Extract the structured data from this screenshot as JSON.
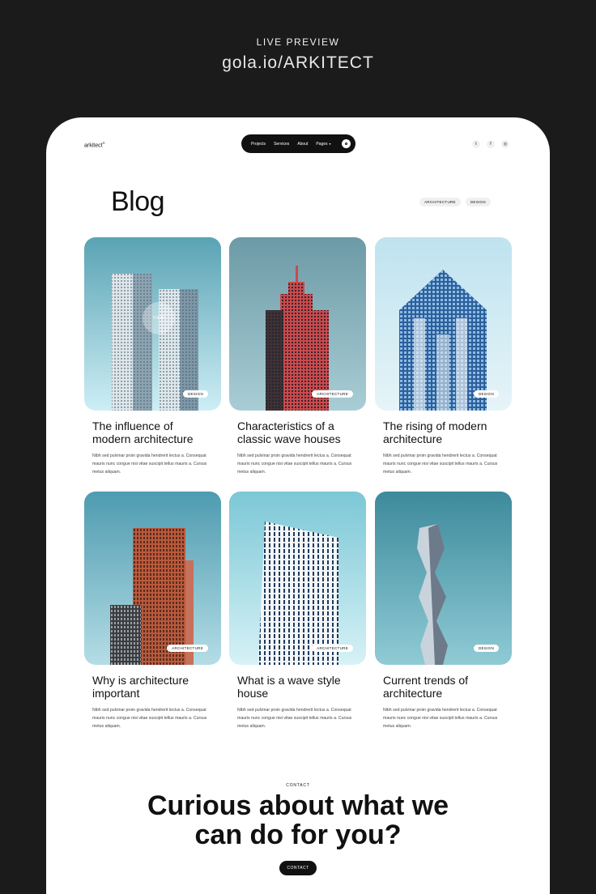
{
  "preview": {
    "label": "LIVE PREVIEW",
    "url": "gola.io/ARKITECT"
  },
  "header": {
    "logo": "arkitect",
    "logo_mark": "®",
    "nav": {
      "projects": "Projects",
      "services": "Services",
      "about": "About",
      "pages": "Pages"
    },
    "socials": {
      "twitter": "t",
      "facebook": "f",
      "instagram": "◎"
    }
  },
  "page": {
    "title": "Blog",
    "filters": [
      "ARCHITECTURE",
      "DESIGN"
    ]
  },
  "posts": [
    {
      "title": "The influence of modern architecture",
      "tag": "DESIGN",
      "excerpt": "Nibh sed pulvinar proin gravida hendrerit lectus a. Consequat mauris nunc congue nisi vitae suscipit tellus mauris a. Cursus metus aliquam.",
      "hover": "VIEW"
    },
    {
      "title": "Characteristics of a classic wave houses",
      "tag": "ARCHITECTURE",
      "excerpt": "Nibh sed pulvinar proin gravida hendrerit lectus a. Consequat mauris nunc congue nisi vitae suscipit tellus mauris a. Cursus metus aliquam."
    },
    {
      "title": "The rising of modern architecture",
      "tag": "DESIGN",
      "excerpt": "Nibh sed pulvinar proin gravida hendrerit lectus a. Consequat mauris nunc congue nisi vitae suscipit tellus mauris a. Cursus metus aliquam."
    },
    {
      "title": "Why is architecture important",
      "tag": "ARCHITECTURE",
      "excerpt": "Nibh sed pulvinar proin gravida hendrerit lectus a. Consequat mauris nunc congue nisi vitae suscipit tellus mauris a. Cursus metus aliquam."
    },
    {
      "title": "What is a wave style house",
      "tag": "ARCHITECTURE",
      "excerpt": "Nibh sed pulvinar proin gravida hendrerit lectus a. Consequat mauris nunc congue nisi vitae suscipit tellus mauris a. Cursus metus aliquam."
    },
    {
      "title": "Current trends of architecture",
      "tag": "DESIGN",
      "excerpt": "Nibh sed pulvinar proin gravida hendrerit lectus a. Consequat mauris nunc congue nisi vitae suscipit tellus mauris a. Cursus metus aliquam."
    }
  ],
  "contact": {
    "eyebrow": "CONTACT",
    "heading_line1": "Curious about what we",
    "heading_line2": "can do for you?",
    "button": "CONTACT"
  },
  "colors": {
    "background": "#1b1b1b",
    "page": "#ffffff",
    "ink": "#111111",
    "pill": "#f0f0f0"
  }
}
